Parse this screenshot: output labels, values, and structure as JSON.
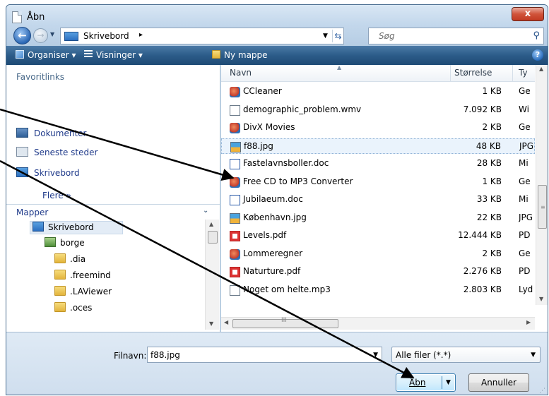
{
  "window": {
    "title": "Åbn",
    "close_glyph": "x"
  },
  "nav": {
    "back_icon": "back-arrow-icon",
    "forward_icon": "forward-arrow-icon"
  },
  "address": {
    "crumb": "Skrivebord",
    "crumb_arrow": "▸"
  },
  "search": {
    "placeholder": "Søg"
  },
  "toolbar": {
    "organize": "Organiser ▾",
    "views": "Visninger ▾",
    "new_folder": "Ny mappe",
    "help": "?"
  },
  "favorites": {
    "heading": "Favoritlinks",
    "items": [
      {
        "label": "Dokumenter"
      },
      {
        "label": "Seneste steder"
      },
      {
        "label": "Skrivebord"
      }
    ],
    "more": "Flere »"
  },
  "folders": {
    "heading": "Mapper",
    "items": [
      {
        "label": "Skrivebord"
      },
      {
        "label": "borge"
      },
      {
        "label": ".dia"
      },
      {
        "label": ".freemind"
      },
      {
        "label": ".LAViewer"
      },
      {
        "label": ".oces"
      }
    ]
  },
  "columns": {
    "name": "Navn",
    "size": "Størrelse",
    "type": "Ty"
  },
  "files": [
    {
      "name": "CCleaner",
      "size": "1 KB",
      "type": "Ge",
      "icon": "shortcut-icon"
    },
    {
      "name": "demographic_problem.wmv",
      "size": "7.092 KB",
      "type": "Wi",
      "icon": "video-file-icon"
    },
    {
      "name": "DivX Movies",
      "size": "2 KB",
      "type": "Ge",
      "icon": "shortcut-icon"
    },
    {
      "name": "f88.jpg",
      "size": "48 KB",
      "type": "JPG",
      "icon": "image-file-icon"
    },
    {
      "name": "Fastelavnsboller.doc",
      "size": "28 KB",
      "type": "Mi",
      "icon": "word-doc-icon"
    },
    {
      "name": "Free CD to MP3 Converter",
      "size": "1 KB",
      "type": "Ge",
      "icon": "shortcut-icon"
    },
    {
      "name": "Jubilaeum.doc",
      "size": "33 KB",
      "type": "Mi",
      "icon": "word-doc-icon"
    },
    {
      "name": "København.jpg",
      "size": "22 KB",
      "type": "JPG",
      "icon": "image-file-icon"
    },
    {
      "name": "Levels.pdf",
      "size": "12.444 KB",
      "type": "PD",
      "icon": "pdf-file-icon"
    },
    {
      "name": "Lommeregner",
      "size": "2 KB",
      "type": "Ge",
      "icon": "shortcut-icon"
    },
    {
      "name": "Naturture.pdf",
      "size": "2.276 KB",
      "type": "PD",
      "icon": "pdf-file-icon"
    },
    {
      "name": "Noget om helte.mp3",
      "size": "2.803 KB",
      "type": "Lyd",
      "icon": "audio-file-icon"
    }
  ],
  "filename": {
    "label": "Filnavn:",
    "value": "f88.jpg"
  },
  "filter": {
    "value": "Alle filer (*.*)"
  },
  "buttons": {
    "open": "Åbn",
    "cancel": "Annuller"
  },
  "colors": {
    "toolbar": "#2c5c89",
    "link": "#1f3a8a",
    "selection": "#eaf3fc",
    "annotation_arrow": "#000000"
  }
}
